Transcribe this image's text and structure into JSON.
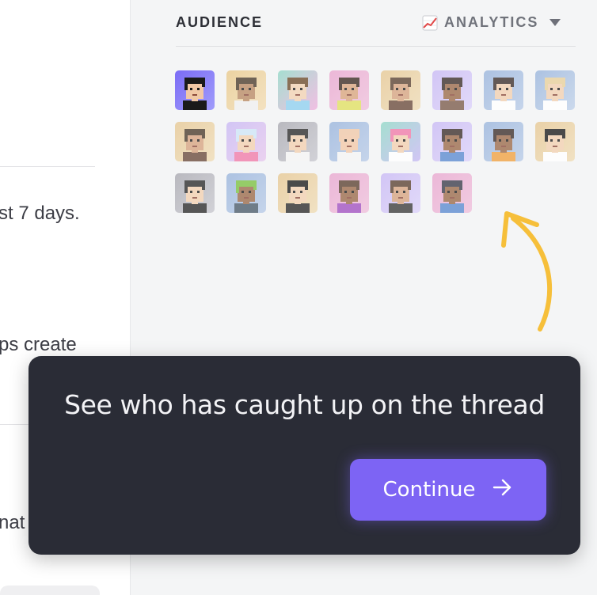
{
  "left_pane": {
    "snippets": [
      "st 7 days.",
      "ps create",
      "nat"
    ]
  },
  "audience": {
    "title": "AUDIENCE",
    "analytics_label": "ANALYTICS",
    "analytics_icon": "chart-increasing-icon",
    "caret_icon": "caret-down-icon",
    "avatars": [
      {
        "bg": [
          "#7b6cf5",
          "#a09cfb"
        ],
        "hair": "#1a1a1a",
        "skin": "#f1c8a6",
        "shirt": "#1a1a1a",
        "seen": true
      },
      {
        "bg": [
          "#e9c98a",
          "#f3ddb3"
        ],
        "hair": "#4a3a2a",
        "skin": "#b98a63",
        "shirt": "#f0f0f0",
        "seen": false
      },
      {
        "bg": [
          "#8fd8c6",
          "#f1b0de"
        ],
        "hair": "#6b4a2a",
        "skin": "#f2d3b3",
        "shirt": "#8fd0f0",
        "seen": false
      },
      {
        "bg": [
          "#e9a6cf",
          "#f0c0dc"
        ],
        "hair": "#3a2a20",
        "skin": "#d9a57d",
        "shirt": "#e0e060",
        "seen": false
      },
      {
        "bg": [
          "#e6c792",
          "#f0dcb5"
        ],
        "hair": "#5a4030",
        "skin": "#d7a37f",
        "shirt": "#6a4a3a",
        "seen": false
      },
      {
        "bg": [
          "#c8b8f5",
          "#dcd2fb"
        ],
        "hair": "#3a2e2a",
        "skin": "#9a6a4a",
        "shirt": "#7a5a4a",
        "seen": false
      },
      {
        "bg": [
          "#98b4dc",
          "#b8cbe8"
        ],
        "hair": "#3a2e2a",
        "skin": "#f2d0b0",
        "shirt": "#ffffff",
        "seen": false
      },
      {
        "bg": [
          "#98b4dc",
          "#c0d2ea"
        ],
        "hair": "#e8d09a",
        "skin": "#f2d0b0",
        "shirt": "#ffffff",
        "seen": false
      },
      {
        "bg": [
          "#e6c792",
          "#f0dcb5"
        ],
        "hair": "#4a3a2a",
        "skin": "#d7a37f",
        "shirt": "#6a4a3a",
        "seen": false
      },
      {
        "bg": [
          "#c8b8f5",
          "#e8c8ee"
        ],
        "hair": "#cfe6f8",
        "skin": "#f2d0b0",
        "shirt": "#f07aa8",
        "seen": false
      },
      {
        "bg": [
          "#a8a8b0",
          "#c8c8cf"
        ],
        "hair": "#2a2a2a",
        "skin": "#f2d0b0",
        "shirt": "#f5f5f5",
        "seen": false
      },
      {
        "bg": [
          "#98b4dc",
          "#b8cbe8"
        ],
        "hair": "#f0c8a8",
        "skin": "#f2c8a8",
        "shirt": "#f5f5f5",
        "seen": false
      },
      {
        "bg": [
          "#8fd8c6",
          "#c8b8f5"
        ],
        "hair": "#f07aa8",
        "skin": "#f2d0b0",
        "shirt": "#ffffff",
        "seen": false
      },
      {
        "bg": [
          "#c8b8f5",
          "#dcd2fb"
        ],
        "hair": "#3a2e2a",
        "skin": "#9a6a4a",
        "shirt": "#5a8ad0",
        "seen": false
      },
      {
        "bg": [
          "#98b4dc",
          "#b8cbe8"
        ],
        "hair": "#3a2e2a",
        "skin": "#9a6a4a",
        "shirt": "#f0a040",
        "seen": false
      },
      {
        "bg": [
          "#e6c792",
          "#f0dcb5"
        ],
        "hair": "#1a1a1a",
        "skin": "#f2d0b0",
        "shirt": "#ffffff",
        "seen": false
      },
      {
        "bg": [
          "#a8a8b0",
          "#c8c8cf"
        ],
        "hair": "#2a2a2a",
        "skin": "#f2d0b0",
        "shirt": "#2a2a2a",
        "seen": false
      },
      {
        "bg": [
          "#98b4dc",
          "#b8cbe8"
        ],
        "hair": "#7ac040",
        "skin": "#9a6a4a",
        "shirt": "#4a5a6a",
        "seen": false
      },
      {
        "bg": [
          "#e6c792",
          "#f0dcb5"
        ],
        "hair": "#1a1a1a",
        "skin": "#f2d0b0",
        "shirt": "#2a2a2a",
        "seen": false
      },
      {
        "bg": [
          "#e9a6cf",
          "#f0c0dc"
        ],
        "hair": "#5a4030",
        "skin": "#9a6a4a",
        "shirt": "#a050c0",
        "seen": false
      },
      {
        "bg": [
          "#c8b8f5",
          "#dcd2fb"
        ],
        "hair": "#5a4030",
        "skin": "#d7a37f",
        "shirt": "#3a3a3a",
        "seen": false
      },
      {
        "bg": [
          "#e9a6cf",
          "#f0c0dc"
        ],
        "hair": "#3a3a4a",
        "skin": "#9a6a4a",
        "shirt": "#5a8ad0",
        "seen": false
      }
    ]
  },
  "arrow_color": "#f6bf3a",
  "tooltip": {
    "message": "See who has caught up on the thread",
    "button_label": "Continue",
    "button_icon": "arrow-right-icon",
    "button_color": "#7d64f4"
  }
}
